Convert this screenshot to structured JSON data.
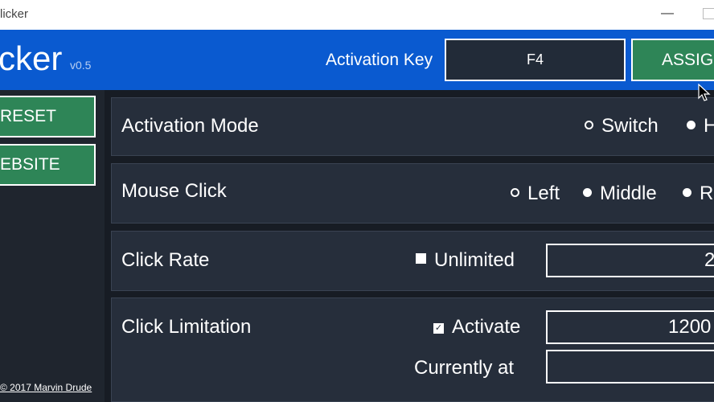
{
  "window": {
    "title": "licker"
  },
  "header": {
    "app_name": "cker",
    "version": "v0.5",
    "activation_key_label": "Activation Key",
    "activation_key_value": "F4",
    "assign_label": "ASSIG"
  },
  "sidebar": {
    "reset_label": "RESET",
    "website_label": "EBSITE",
    "copyright": "© 2017 Marvin Drude"
  },
  "panels": {
    "activation_mode": {
      "title": "Activation Mode",
      "options": [
        "Switch",
        "H"
      ],
      "selected": "Switch"
    },
    "mouse_click": {
      "title": "Mouse Click",
      "options": [
        "Left",
        "Middle",
        "R"
      ],
      "selected": "Left"
    },
    "click_rate": {
      "title": "Click Rate",
      "unlimited_label": "Unlimited",
      "unlimited_checked": false,
      "rate_value": "2"
    },
    "click_limitation": {
      "title": "Click Limitation",
      "activate_label": "Activate",
      "activate_checked": true,
      "limit_value": "1200",
      "current_label": "Currently at",
      "current_value": ""
    }
  },
  "colors": {
    "header_bg": "#0a5ad0",
    "button_green": "#2e8557",
    "panel_bg": "#262e3b",
    "main_bg": "#171c24",
    "sidebar_bg": "#1f252e"
  }
}
